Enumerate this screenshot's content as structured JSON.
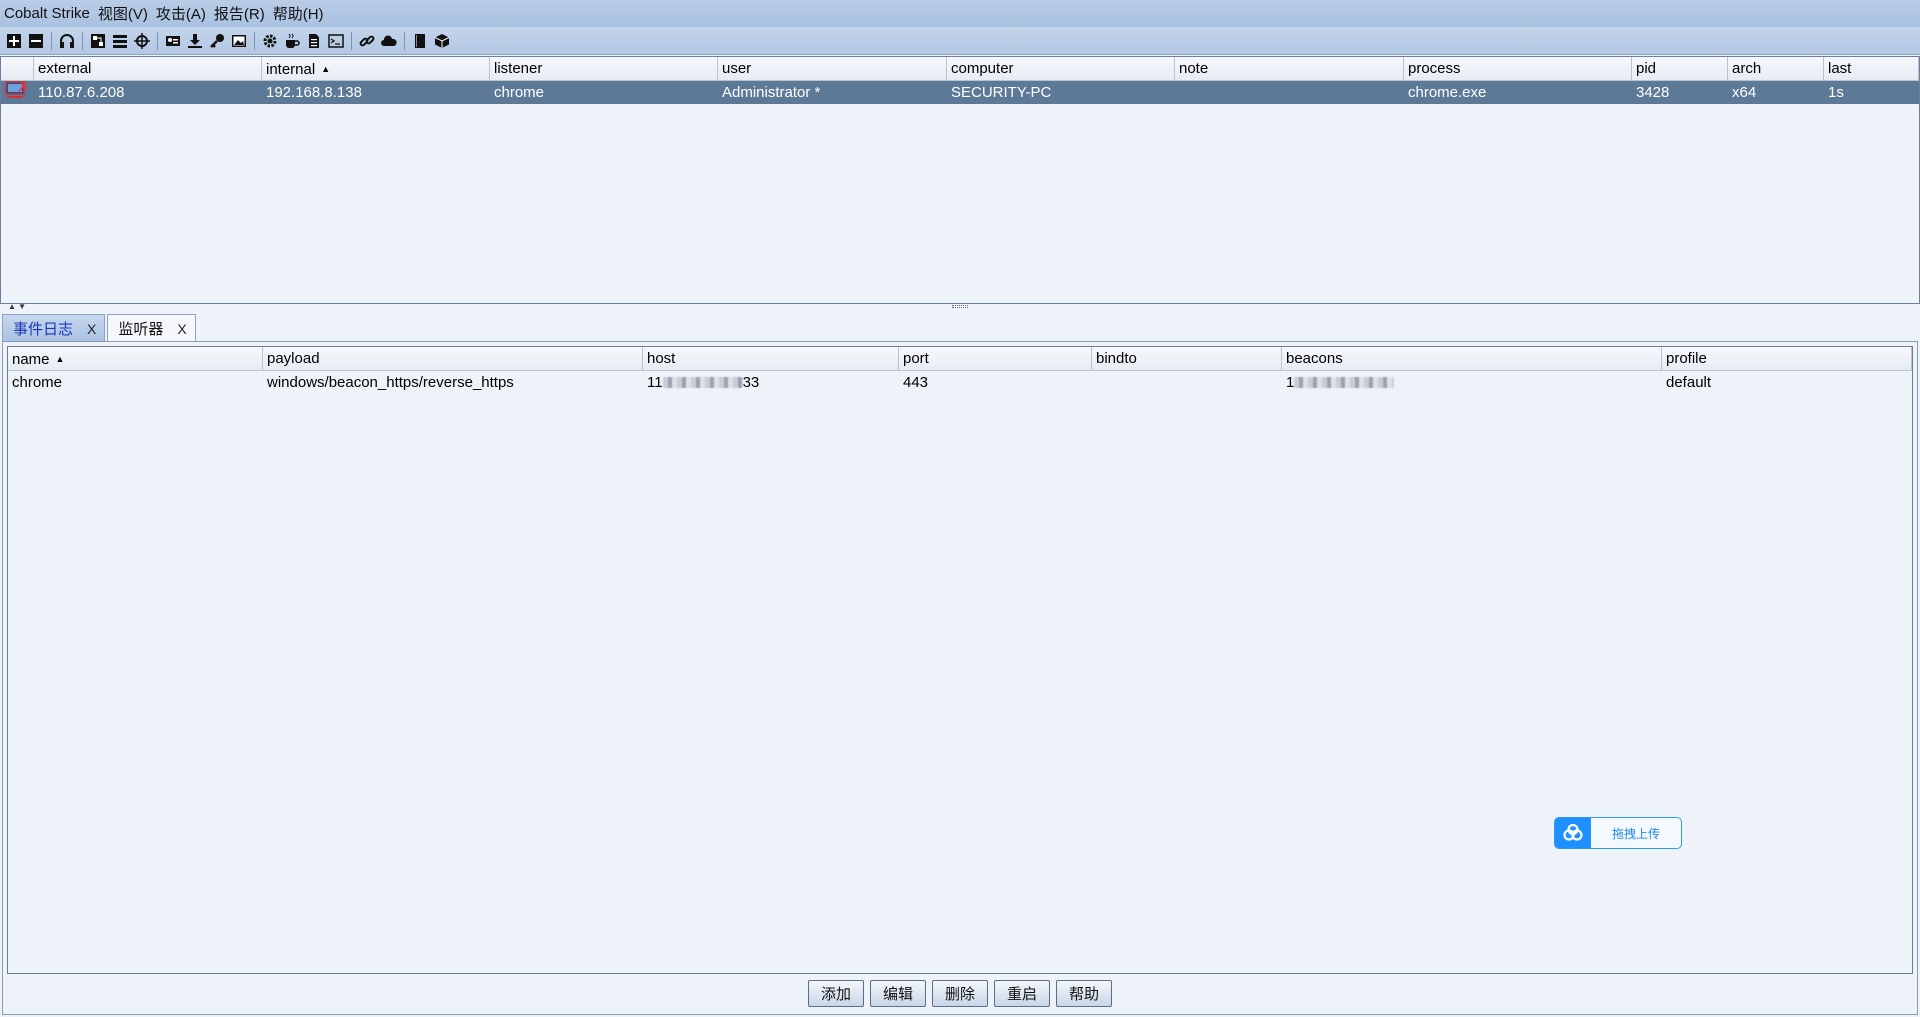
{
  "app": {
    "title": "Cobalt Strike",
    "menus": [
      "视图(V)",
      "攻击(A)",
      "报告(R)",
      "帮助(H)"
    ]
  },
  "toolbar": {
    "icons": [
      "add-icon",
      "remove-icon",
      "headphones-icon",
      "pivot-graph-icon",
      "session-table-icon",
      "target-icon",
      "credentials-icon",
      "downloads-icon",
      "keys-icon",
      "screenshots-icon",
      "settings-icon",
      "java-icon",
      "document-icon",
      "console-icon",
      "link-icon",
      "cloud-icon",
      "book-icon",
      "package-icon"
    ]
  },
  "sessions": {
    "columns": [
      "",
      "external",
      "internal",
      "listener",
      "user",
      "computer",
      "note",
      "process",
      "pid",
      "arch",
      "last"
    ],
    "sorted_column": "internal",
    "rows": [
      {
        "external": "110.87.6.208",
        "internal": "192.168.8.138",
        "listener": "chrome",
        "user": "Administrator *",
        "computer": "SECURITY-PC",
        "note": "",
        "process": "chrome.exe",
        "pid": "3428",
        "arch": "x64",
        "last": "1s"
      }
    ]
  },
  "tabs": [
    {
      "label": "事件日志",
      "close": "X",
      "active": false
    },
    {
      "label": "监听器",
      "close": "X",
      "active": true
    }
  ],
  "listeners": {
    "columns": [
      "name",
      "payload",
      "host",
      "port",
      "bindto",
      "beacons",
      "profile"
    ],
    "sorted_column": "name",
    "rows": [
      {
        "name": "chrome",
        "payload": "windows/beacon_https/reverse_https",
        "host_prefix": "11",
        "host_suffix": "33",
        "port": "443",
        "bindto": "",
        "beacons_prefix": "1",
        "profile": "default"
      }
    ]
  },
  "buttons": {
    "add": "添加",
    "edit": "编辑",
    "delete": "删除",
    "restart": "重启",
    "help": "帮助"
  },
  "upload_widget": {
    "label": "拖拽上传"
  }
}
